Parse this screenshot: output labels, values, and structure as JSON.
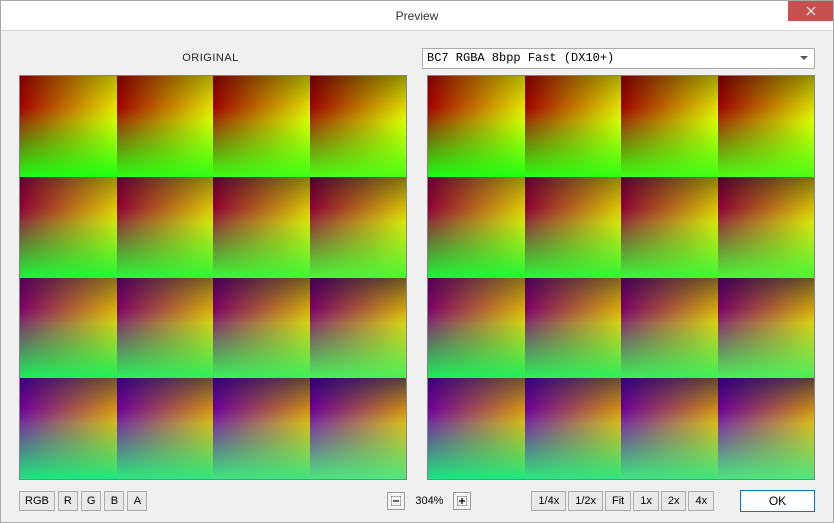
{
  "window": {
    "title": "Preview"
  },
  "labels": {
    "original": "ORIGINAL"
  },
  "format": {
    "selected": "BC7   RGBA  8bpp  Fast (DX10+)"
  },
  "channels": [
    {
      "label": "RGB"
    },
    {
      "label": "R"
    },
    {
      "label": "G"
    },
    {
      "label": "B"
    },
    {
      "label": "A"
    }
  ],
  "zoom": {
    "value": "304%"
  },
  "scales": [
    {
      "label": "1/4x"
    },
    {
      "label": "1/2x"
    },
    {
      "label": "Fit"
    },
    {
      "label": "1x"
    },
    {
      "label": "2x"
    },
    {
      "label": "4x"
    }
  ],
  "buttons": {
    "ok": "OK"
  },
  "chart_data": {
    "type": "table",
    "note": "4x4 grids of RGB gradient tiles; each tile is a 2D R/G gradient with varying B and overlay per row",
    "rows": 4,
    "cols": 4,
    "tile_gradients": "top-left red→top-right yellow, bottom-left green→bottom-right yellow-green; rows 2-4 add increasing blue/magenta shift"
  }
}
